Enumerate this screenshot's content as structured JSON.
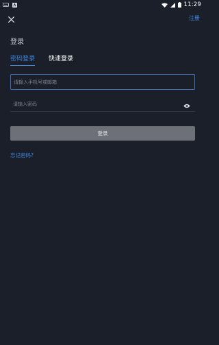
{
  "status_bar": {
    "time": "11:29",
    "left_icons": [
      "keyboard-icon",
      "app-notification-icon"
    ],
    "right_icons": [
      "wifi-icon",
      "cell-signal-icon",
      "battery-icon"
    ]
  },
  "header": {
    "close_icon": "close-icon",
    "register_label": "注册"
  },
  "page_title": "登录",
  "tabs": [
    {
      "label": "密码登录",
      "active": true
    },
    {
      "label": "快速登录",
      "active": false
    }
  ],
  "form": {
    "phone_placeholder": "请输入手机号或邮箱",
    "phone_value": "",
    "password_placeholder": "请输入密码",
    "password_value": "",
    "password_toggle_icon": "eye-icon",
    "submit_label": "登录",
    "forgot_label": "忘记密码?"
  },
  "colors": {
    "background": "#1b1f2a",
    "accent": "#3b86e0",
    "button_disabled": "#6d7078"
  }
}
